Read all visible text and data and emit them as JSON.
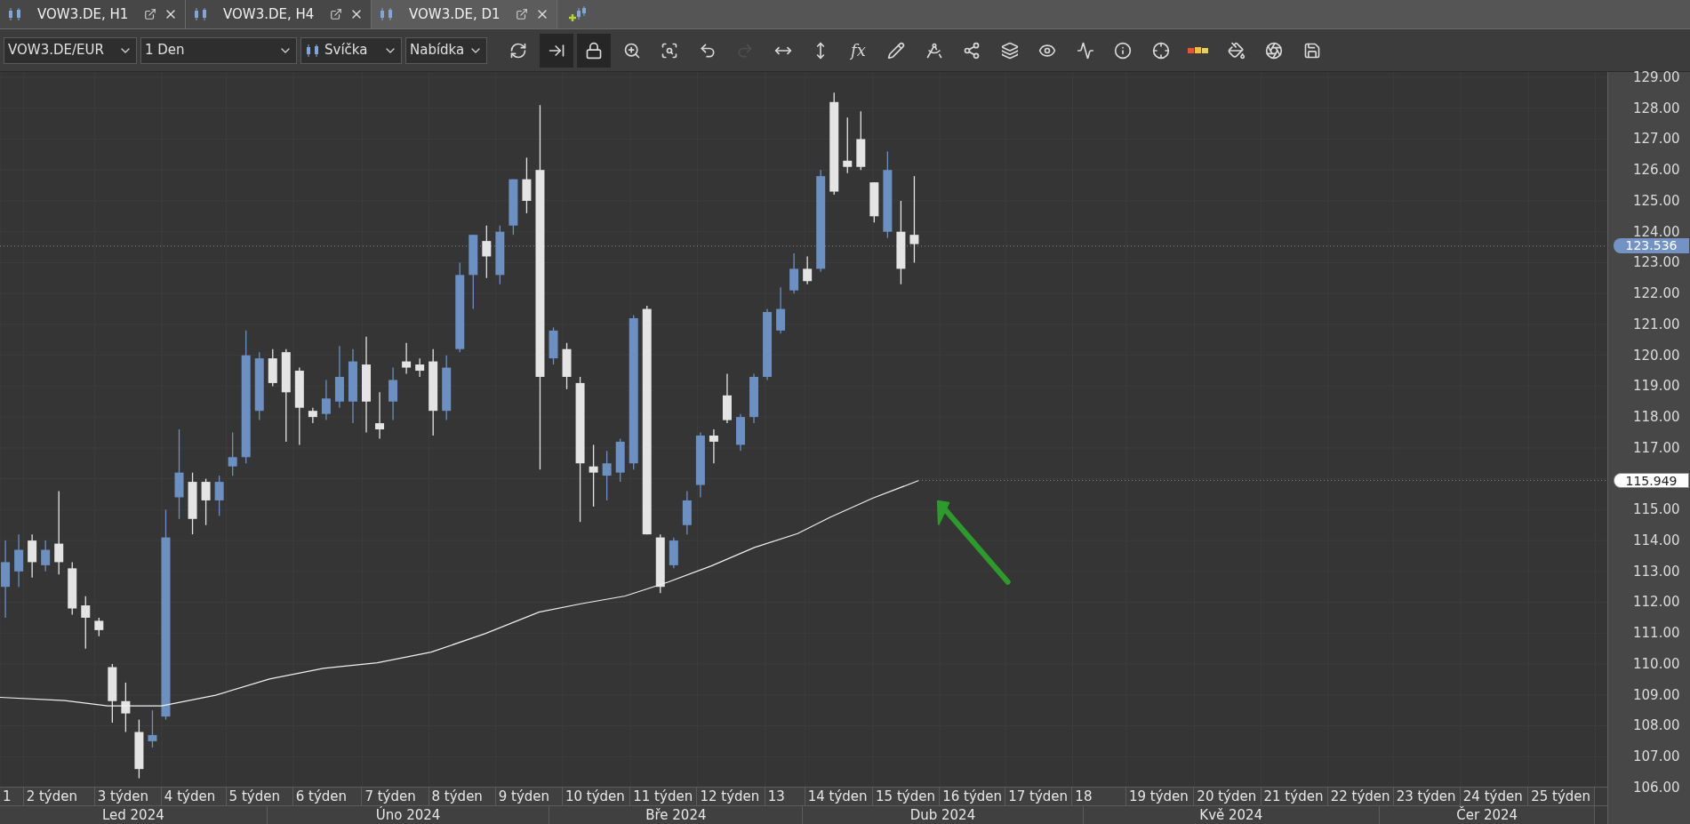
{
  "tabs": [
    {
      "title": "VOW3.DE, H1",
      "selected": false
    },
    {
      "title": "VOW3.DE, H4",
      "selected": false
    },
    {
      "title": "VOW3.DE, D1",
      "selected": true
    }
  ],
  "toolbar": {
    "symbol": "VOW3.DE/EUR",
    "period": "1 Den",
    "chart_type": "Svíčka",
    "price_type": "Nabídka",
    "tools": [
      {
        "kind": "icon",
        "selected": false,
        "disabled": false
      },
      {
        "kind": "icon",
        "selected": true,
        "disabled": false
      },
      {
        "kind": "icon",
        "selected": true,
        "disabled": false
      },
      {
        "kind": "icon",
        "selected": false,
        "disabled": false
      },
      {
        "kind": "icon",
        "selected": false,
        "disabled": false
      },
      {
        "kind": "icon",
        "selected": false,
        "disabled": false
      },
      {
        "kind": "icon",
        "selected": false,
        "disabled": true
      },
      {
        "kind": "icon",
        "selected": false,
        "disabled": false
      },
      {
        "kind": "icon",
        "selected": false,
        "disabled": false
      },
      {
        "kind": "text",
        "label": "fx",
        "selected": false,
        "disabled": false
      },
      {
        "kind": "icon",
        "selected": false,
        "disabled": false
      },
      {
        "kind": "icon",
        "selected": false,
        "disabled": false
      },
      {
        "kind": "icon",
        "selected": false,
        "disabled": false
      },
      {
        "kind": "icon",
        "selected": false,
        "disabled": false
      },
      {
        "kind": "icon",
        "selected": false,
        "disabled": false
      },
      {
        "kind": "icon",
        "selected": false,
        "disabled": false
      },
      {
        "kind": "icon",
        "selected": false,
        "disabled": false
      },
      {
        "kind": "icon",
        "selected": false,
        "disabled": false
      },
      {
        "kind": "icon",
        "selected": false,
        "disabled": false
      },
      {
        "kind": "icon",
        "selected": false,
        "disabled": false
      },
      {
        "kind": "icon",
        "selected": false,
        "disabled": false
      },
      {
        "kind": "icon",
        "selected": false,
        "disabled": false
      }
    ]
  },
  "price_axis": {
    "labels": [
      "129.00",
      "128.00",
      "127.00",
      "126.00",
      "125.00",
      "124.00",
      "123.00",
      "122.00",
      "121.00",
      "120.00",
      "119.00",
      "118.00",
      "117.00",
      "115.00",
      "114.00",
      "113.00",
      "112.00",
      "111.00",
      "110.00",
      "109.00",
      "108.00",
      "107.00",
      "106.00"
    ],
    "markers": [
      {
        "value": "123.536",
        "kind": "last_price"
      },
      {
        "value": "115.949",
        "kind": "indicator"
      }
    ]
  },
  "time_axis": {
    "weeks": [
      "1",
      "2 týden",
      "3 týden",
      "4 týden",
      "5 týden",
      "6 týden",
      "7 týden",
      "8 týden",
      "9 týden",
      "10 týden",
      "11 týden",
      "12 týden",
      "13",
      "14 týden",
      "15 týden",
      "16 týden",
      "17 týden",
      "18",
      "19 týden",
      "20 týden",
      "21 týden",
      "22 týden",
      "23 týden",
      "24 týden",
      "25 týden"
    ],
    "months": [
      "Led 2024",
      "Úno 2024",
      "Bře 2024",
      "Dub 2024",
      "Kvě 2024",
      "Čer 2024"
    ]
  }
}
